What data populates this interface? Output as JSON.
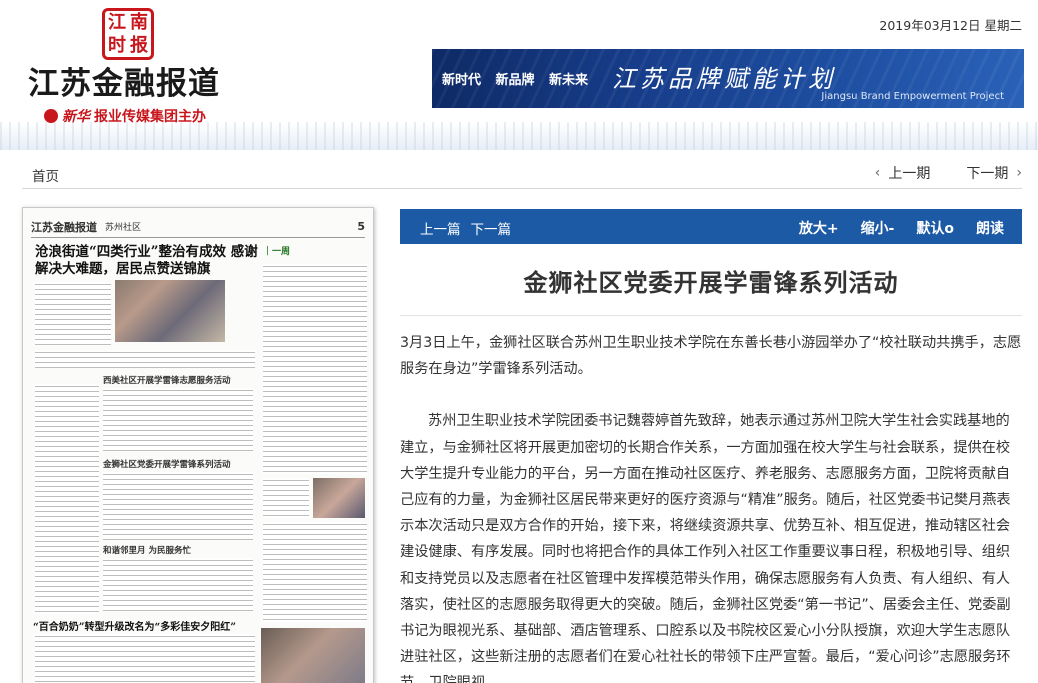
{
  "header": {
    "seal_chars": [
      "江",
      "南",
      "时",
      "报"
    ],
    "masthead": "江苏金融报道",
    "host_logo": "新华",
    "host_text": "报业传媒集团主办",
    "date": "2019年03月12日 星期二",
    "banner": {
      "slogan": "新时代 新品牌 新未来",
      "title": "江苏品牌赋能计划",
      "subtitle": "Jiangsu Brand Empowerment Project"
    }
  },
  "nav": {
    "home": "首页",
    "prev_issue": "上一期",
    "next_issue": "下一期"
  },
  "paper": {
    "masthead": "江苏金融报道",
    "section": "苏州社区",
    "page_num": "5",
    "headline": "沧浪街道“四类行业”整治有成效 感谢解决大难题，居民点赞送锦旗",
    "section_tag": "｜一周",
    "caption1": "西美社区开展学雷锋志愿服务活动",
    "caption2": "金狮社区党委开展学雷锋系列活动",
    "caption3": "和谐邻里月 为民服务忙",
    "bottom_headline": "“百合奶奶”转型升级改名为“多彩佳安夕阳红”"
  },
  "toolbar": {
    "prev_article": "上一篇",
    "next_article": "下一篇",
    "zoom_in": "放大+",
    "zoom_out": "缩小-",
    "default": "默认o",
    "read_aloud": "朗读"
  },
  "article": {
    "title": "金狮社区党委开展学雷锋系列活动",
    "lead": "3月3日上午，金狮社区联合苏州卫生职业技术学院在东善长巷小游园举办了“校社联动共携手，志愿服务在身边”学雷锋系列活动。",
    "paragraph": "苏州卫生职业技术学院团委书记魏蓉婷首先致辞，她表示通过苏州卫院大学生社会实践基地的建立，与金狮社区将开展更加密切的长期合作关系，一方面加强在校大学生与社会联系，提供在校大学生提升专业能力的平台，另一方面在推动社区医疗、养老服务、志愿服务方面，卫院将贡献自己应有的力量，为金狮社区居民带来更好的医疗资源与“精准”服务。随后，社区党委书记樊月燕表示本次活动只是双方合作的开始，接下来，将继续资源共享、优势互补、相互促进，推动辖区社会建设健康、有序发展。同时也将把合作的具体工作列入社区工作重要议事日程，积极地引导、组织和支持党员以及志愿者在社区管理中发挥模范带头作用，确保志愿服务有人负责、有人组织、有人落实，使社区的志愿服务取得更大的突破。随后，金狮社区党委“第一书记”、居委会主任、党委副书记为眼视光系、基础部、酒店管理系、口腔系以及书院校区爱心小分队授旗，欢迎大学生志愿队进驻社区，这些新注册的志愿者们在爱心社社长的带领下庄严宣誓。最后，“爱心问诊”志愿服务环节，卫院眼视"
  },
  "colors": {
    "toolbar_blue": "#1c5aa5",
    "accent_red": "#c8161d",
    "banner_navy": "#173d8a"
  }
}
